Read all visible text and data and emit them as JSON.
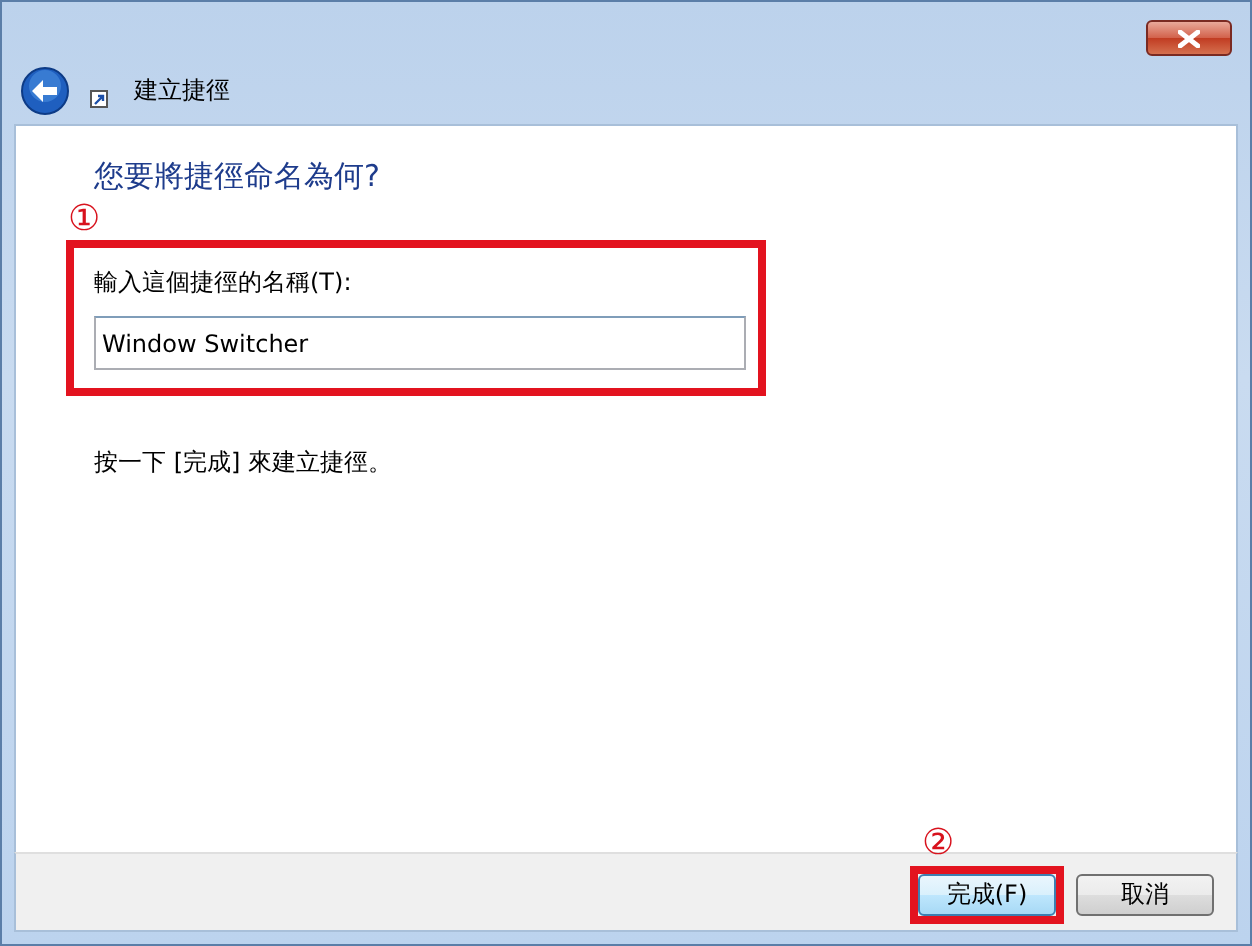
{
  "window": {
    "title": "建立捷徑"
  },
  "heading": "您要將捷徑命名為何?",
  "name_field": {
    "label": "輸入這個捷徑的名稱(T):",
    "value": "Window Switcher",
    "annotation": "①"
  },
  "instruction": "按一下 [完成] 來建立捷徑。",
  "buttons": [
    {
      "label": "完成(F)",
      "kind": "default",
      "annotation": "②"
    },
    {
      "label": "取消",
      "kind": "normal"
    }
  ]
}
